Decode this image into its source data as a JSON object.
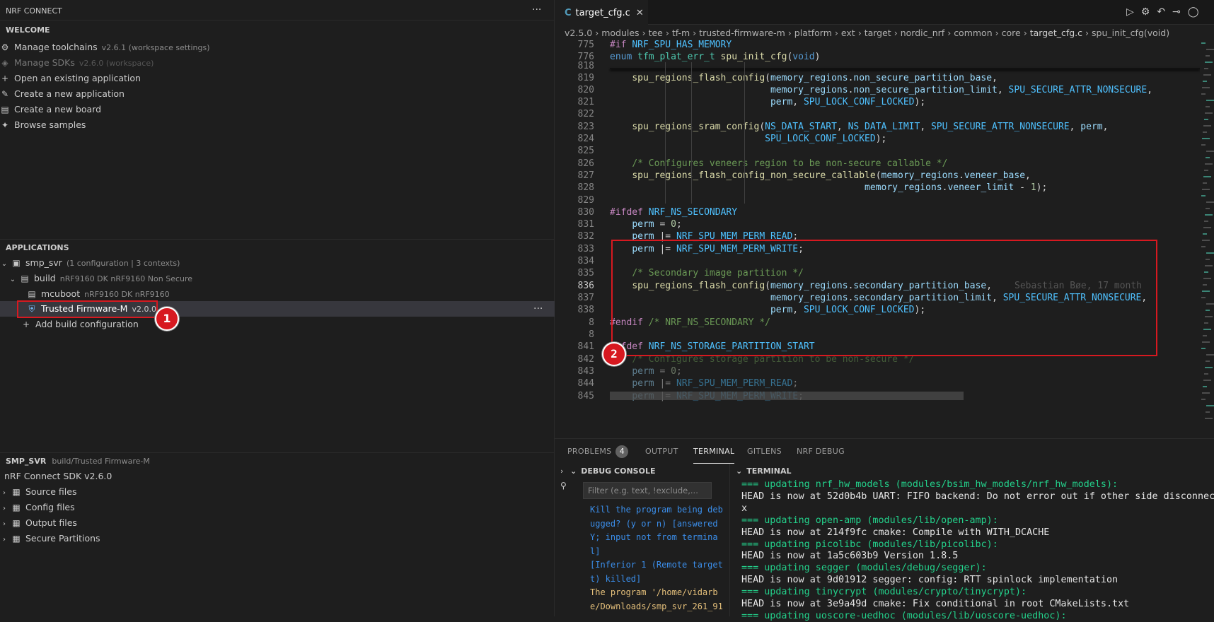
{
  "left": {
    "title": "NRF CONNECT",
    "more": "···",
    "welcome": {
      "header": "WELCOME",
      "items": [
        {
          "label": "Manage toolchains",
          "sub": "v2.6.1 (workspace settings)",
          "icon": "toolchain-icon"
        },
        {
          "label": "Manage SDKs",
          "sub": "v2.6.0 (workspace)",
          "icon": "sdk-icon"
        },
        {
          "label": "Open an existing application",
          "icon": "plus-icon"
        },
        {
          "label": "Create a new application",
          "icon": "wand-icon"
        },
        {
          "label": "Create a new board",
          "icon": "board-icon"
        },
        {
          "label": "Browse samples",
          "icon": "samples-icon"
        }
      ]
    },
    "applications": {
      "header": "APPLICATIONS",
      "app": {
        "name": "smp_svr",
        "sub": "(1 configuration | 3 contexts)"
      },
      "build": {
        "name": "build",
        "sub": "nRF9160 DK nRF9160 Non Secure"
      },
      "mcuboot": {
        "name": "mcuboot",
        "sub": "nRF9160 DK nRF9160"
      },
      "tfm": {
        "name": "Trusted Firmware-M",
        "sub": "v2.0.0"
      },
      "add": "Add build configuration"
    },
    "details": {
      "header": "SMP_SVR",
      "header_sub": "build/Trusted Firmware-M",
      "sdk": "nRF Connect SDK v2.6.0",
      "items": [
        "Source files",
        "Config files",
        "Output files",
        "Secure Partitions"
      ]
    },
    "badge1": "1"
  },
  "editor": {
    "tab": "target_cfg.c",
    "tab_lang": "C",
    "breadcrumbs": [
      "v2.5.0",
      "modules",
      "tee",
      "tf-m",
      "trusted-firmware-m",
      "platform",
      "ext",
      "target",
      "nordic_nrf",
      "common",
      "core",
      "target_cfg.c",
      "spu_init_cfg(void)"
    ],
    "line_numbers": [
      "775",
      "776",
      "818",
      "819",
      "820",
      "821",
      "822",
      "823",
      "824",
      "825",
      "826",
      "827",
      "828",
      "829",
      "830",
      "831",
      "832",
      "833",
      "834",
      "835",
      "836",
      "837",
      "838",
      "8",
      "8",
      "841",
      "842",
      "843",
      "844",
      "845"
    ],
    "blame": "Sebastian Bøe, 17 month",
    "badge2": "2"
  },
  "panel": {
    "tabs": [
      "PROBLEMS",
      "OUTPUT",
      "TERMINAL",
      "GITLENS",
      "NRF DEBUG"
    ],
    "problems_count": "4",
    "debug_console": "DEBUG CONSOLE",
    "terminal": "TERMINAL",
    "filter_placeholder": "Filter (e.g. text, !exclude,...",
    "debug_lines": [
      {
        "text": "Kill the program being deb",
        "color": "#3b8eea"
      },
      {
        "text": "ugged? (y or n) [answered",
        "color": "#3b8eea"
      },
      {
        "text": "Y; input not from termina",
        "color": "#3b8eea"
      },
      {
        "text": "l]",
        "color": "#3b8eea"
      },
      {
        "text": "[Inferior 1 (Remote target",
        "color": "#3b8eea"
      },
      {
        "text": "t) killed]",
        "color": "#3b8eea"
      },
      {
        "text": "The program '/home/vidarb",
        "color": "#e5c07b"
      },
      {
        "text": "e/Downloads/smp_svr_261_91",
        "color": "#e5c07b"
      }
    ],
    "terminal_lines": [
      {
        "text": "=== updating nrf_hw_models (modules/bsim_hw_models/nrf_hw_models):",
        "green": true
      },
      {
        "text": "HEAD is now at 52d0b4b UART: FIFO backend: Do not error out if other side disconnect",
        "green": false
      },
      {
        "text": "x",
        "green": false
      },
      {
        "text": "=== updating open-amp (modules/lib/open-amp):",
        "green": true
      },
      {
        "text": "HEAD is now at 214f9fc cmake: Compile with WITH_DCACHE",
        "green": false
      },
      {
        "text": "=== updating picolibc (modules/lib/picolibc):",
        "green": true
      },
      {
        "text": "HEAD is now at 1a5c603b9 Version 1.8.5",
        "green": false
      },
      {
        "text": "=== updating segger (modules/debug/segger):",
        "green": true
      },
      {
        "text": "HEAD is now at 9d01912 segger: config: RTT spinlock implementation",
        "green": false
      },
      {
        "text": "=== updating tinycrypt (modules/crypto/tinycrypt):",
        "green": true
      },
      {
        "text": "HEAD is now at 3e9a49d cmake: Fix conditional in root CMakeLists.txt",
        "green": false
      },
      {
        "text": "=== updating uoscore-uedhoc (modules/lib/uoscore-uedhoc):",
        "green": true
      }
    ]
  },
  "colors": {
    "highlight": "#d71920",
    "bg": "#1e1e1e",
    "selection": "#37373d"
  }
}
